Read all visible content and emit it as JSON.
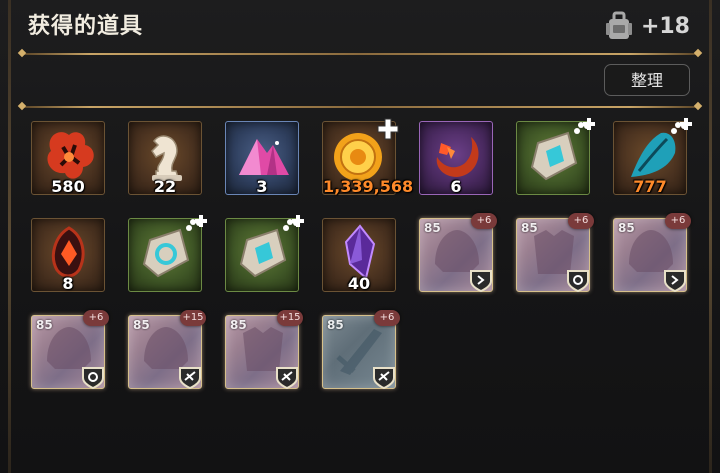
{
  "header": {
    "title": "获得的道具",
    "bag_count": "+18"
  },
  "toolbar": {
    "sort_label": "整理"
  },
  "items_row1": [
    {
      "icon": "red-flower-petals-icon",
      "count": "580"
    },
    {
      "icon": "chess-knight-icon",
      "count": "22"
    },
    {
      "icon": "pink-crystal-pile-icon",
      "count": "3"
    },
    {
      "icon": "gold-sun-coin-icon",
      "count": "1,339,568"
    },
    {
      "icon": "red-flame-horn-icon",
      "count": "6"
    },
    {
      "icon": "pet-rune-stone-cyan-icon",
      "count": ""
    },
    {
      "icon": "blue-feather-blade-icon",
      "count": "777"
    }
  ],
  "items_row2": [
    {
      "icon": "red-ember-gem-icon",
      "count": "8"
    },
    {
      "icon": "pet-rune-stone-ring-icon",
      "count": ""
    },
    {
      "icon": "pet-rune-stone-cyan-icon",
      "count": ""
    },
    {
      "icon": "purple-crystal-shard-icon",
      "count": "40"
    },
    {
      "icon": "helmet-equipment-icon",
      "level": "85",
      "enhance": "+6"
    },
    {
      "icon": "armor-equipment-icon",
      "level": "85",
      "enhance": "+6"
    },
    {
      "icon": "helmet-equipment-icon",
      "level": "85",
      "enhance": "+6"
    }
  ],
  "items_row3": [
    {
      "icon": "helmet-equipment-icon",
      "level": "85",
      "enhance": "+6"
    },
    {
      "icon": "helmet-equipment-icon",
      "level": "85",
      "enhance": "+15"
    },
    {
      "icon": "armor-equipment-icon",
      "level": "85",
      "enhance": "+15"
    },
    {
      "icon": "sword-equipment-icon",
      "level": "85",
      "enhance": "+6"
    }
  ],
  "colors": {
    "accent_gold": "#c8a466",
    "count_orange": "#ff8a2a"
  }
}
